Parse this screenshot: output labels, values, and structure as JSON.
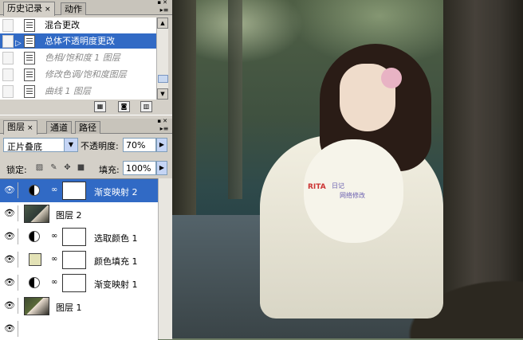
{
  "history_panel": {
    "tabs": [
      {
        "label": "历史记录",
        "close": "×",
        "active": true
      },
      {
        "label": "动作",
        "active": false
      }
    ],
    "menu_icon": "panel-menu-icon",
    "items": [
      {
        "label": "混合更改",
        "state": "normal"
      },
      {
        "label": "总体不透明度更改",
        "state": "selected",
        "marker": "history-state-arrow-icon"
      },
      {
        "label": "色相/饱和度 1 图层",
        "state": "undone"
      },
      {
        "label": "修改色调/饱和度图层",
        "state": "undone"
      },
      {
        "label": "曲线 1 图层",
        "state": "undone"
      }
    ],
    "footer_icons": [
      "new-document-from-state-icon",
      "snapshot-camera-icon",
      "trash-icon"
    ]
  },
  "layers_panel": {
    "tabs": [
      {
        "label": "图层",
        "close": "×",
        "active": true
      },
      {
        "label": "通道",
        "active": false
      },
      {
        "label": "路径",
        "active": false
      }
    ],
    "blend_mode": "正片叠底",
    "opacity_label": "不透明度:",
    "opacity_value": "70%",
    "lock_label": "锁定:",
    "lock_icons": [
      "lock-transparency-icon",
      "lock-brush-icon",
      "lock-move-icon",
      "lock-all-icon"
    ],
    "fill_label": "填充:",
    "fill_value": "100%",
    "layers": [
      {
        "name": "渐变映射 2",
        "type": "adjustment",
        "selected": true
      },
      {
        "name": "图层 2",
        "type": "image",
        "selected": false
      },
      {
        "name": "选取颜色 1",
        "type": "adjustment",
        "selected": false
      },
      {
        "name": "颜色填充 1",
        "type": "fill",
        "selected": false
      },
      {
        "name": "渐变映射 1",
        "type": "adjustment",
        "selected": false
      },
      {
        "name": "图层 1",
        "type": "image",
        "selected": false
      }
    ]
  },
  "canvas": {
    "watermark_brand": "RITA",
    "watermark_line1": "日记",
    "watermark_line2": "网络修改"
  },
  "colors": {
    "selection": "#316ac5",
    "panel_bg": "#d4d0c8",
    "fill_swatch": "#e3e2b6"
  }
}
